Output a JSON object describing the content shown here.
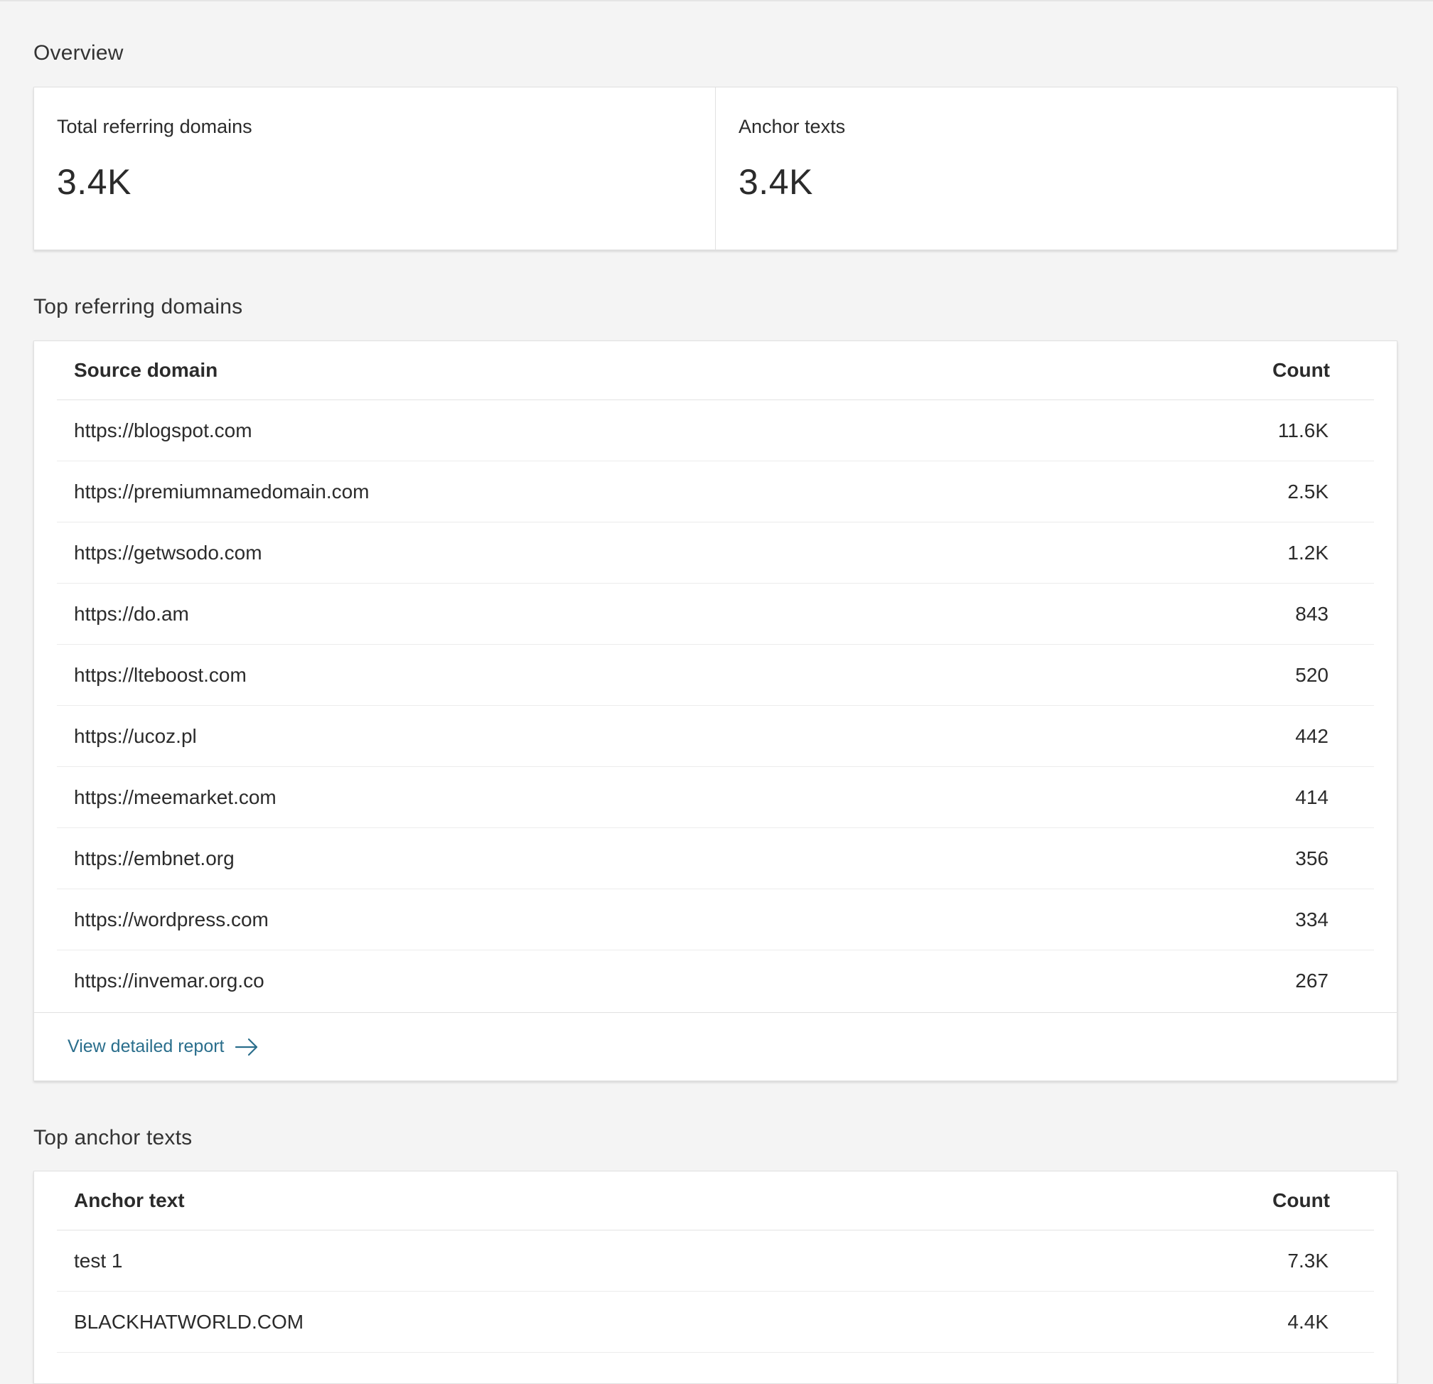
{
  "overview": {
    "title": "Overview",
    "metrics": [
      {
        "label": "Total referring domains",
        "value": "3.4K"
      },
      {
        "label": "Anchor texts",
        "value": "3.4K"
      }
    ]
  },
  "top_domains": {
    "title": "Top referring domains",
    "columns": [
      "Source domain",
      "Count"
    ],
    "rows": [
      {
        "domain": "https://blogspot.com",
        "count": "11.6K"
      },
      {
        "domain": "https://premiumnamedomain.com",
        "count": "2.5K"
      },
      {
        "domain": "https://getwsodo.com",
        "count": "1.2K"
      },
      {
        "domain": "https://do.am",
        "count": "843"
      },
      {
        "domain": "https://lteboost.com",
        "count": "520"
      },
      {
        "domain": "https://ucoz.pl",
        "count": "442"
      },
      {
        "domain": "https://meemarket.com",
        "count": "414"
      },
      {
        "domain": "https://embnet.org",
        "count": "356"
      },
      {
        "domain": "https://wordpress.com",
        "count": "334"
      },
      {
        "domain": "https://invemar.org.co",
        "count": "267"
      }
    ],
    "footer_link": "View detailed report",
    "footer_icon": "arrow-right-icon"
  },
  "top_anchors": {
    "title": "Top anchor texts",
    "columns": [
      "Anchor text",
      "Count"
    ],
    "rows": [
      {
        "text": "test 1",
        "count": "7.3K"
      },
      {
        "text": "BLACKHATWORLD.COM",
        "count": "4.4K"
      }
    ]
  },
  "colors": {
    "background": "#f4f4f4",
    "card": "#ffffff",
    "link": "#2a6e8c",
    "text": "#2b2b2b"
  }
}
